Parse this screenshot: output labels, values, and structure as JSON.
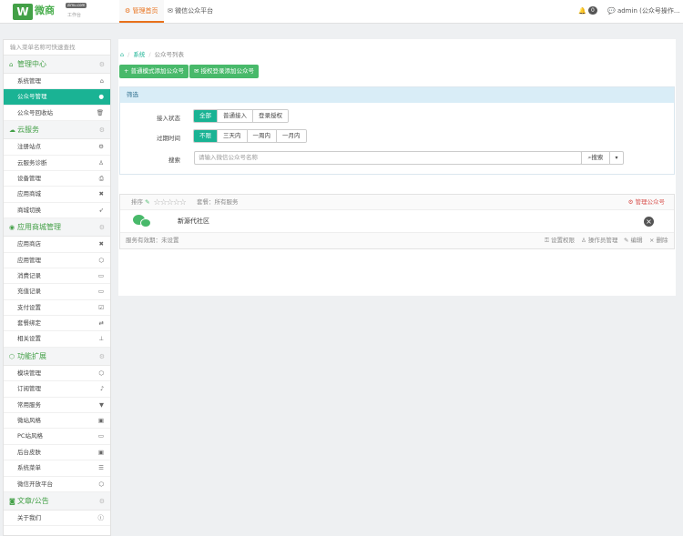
{
  "topbar": {
    "logo_text": "微商",
    "logo_sub": "工作台",
    "logo_bubble": "zimu.com",
    "tabs": [
      {
        "label": "管理首页",
        "icon": "gear-icon"
      },
      {
        "label": "微信公众平台",
        "icon": "wechat-icon"
      }
    ],
    "bell_count": "0",
    "user_label": "admin (公众号操作..."
  },
  "sidebar": {
    "search_placeholder": "输入菜单名称可快速查找",
    "groups": [
      {
        "title": "管理中心",
        "items": [
          "系统管理",
          "公众号管理",
          "公众号回收站"
        ]
      },
      {
        "title": "云服务",
        "items": [
          "注册站点",
          "云服务诊断",
          "设备管理",
          "应用商城",
          "商城切换"
        ]
      },
      {
        "title": "应用商城管理",
        "items": [
          "应用商店",
          "应用管理",
          "消费记录",
          "充值记录",
          "支付设置",
          "套餐绑定",
          "相关设置"
        ]
      },
      {
        "title": "功能扩展",
        "items": [
          "模块管理",
          "订阅管理",
          "常用服务",
          "微站风格",
          "PC站风格",
          "后台皮肤",
          "系统菜单",
          "微信开放平台"
        ]
      },
      {
        "title": "文章/公告",
        "items": [
          "关于我们"
        ]
      }
    ]
  },
  "breadcrumb": {
    "items": [
      "系统",
      "公众号列表"
    ]
  },
  "actions": {
    "add_normal": "普通模式添加公众号",
    "add_auth": "授权登录添加公众号"
  },
  "filter": {
    "title": "筛选",
    "access_label": "接入状态",
    "access_options": [
      "全部",
      "普通接入",
      "登录授权"
    ],
    "expire_label": "过期时间",
    "expire_options": [
      "不限",
      "三天内",
      "一周内",
      "一月内"
    ],
    "search_label": "搜索",
    "search_placeholder": "请输入微信公众号名称",
    "search_button": "搜索"
  },
  "account": {
    "sort_label": "排序",
    "package_text": "套餐：所有服务",
    "manage_link": "管理公众号",
    "name": "新源代社区",
    "service_text": "服务有效期：未设置",
    "footer_actions": [
      "设置权限",
      "操作员管理",
      "编辑",
      "删除"
    ]
  }
}
